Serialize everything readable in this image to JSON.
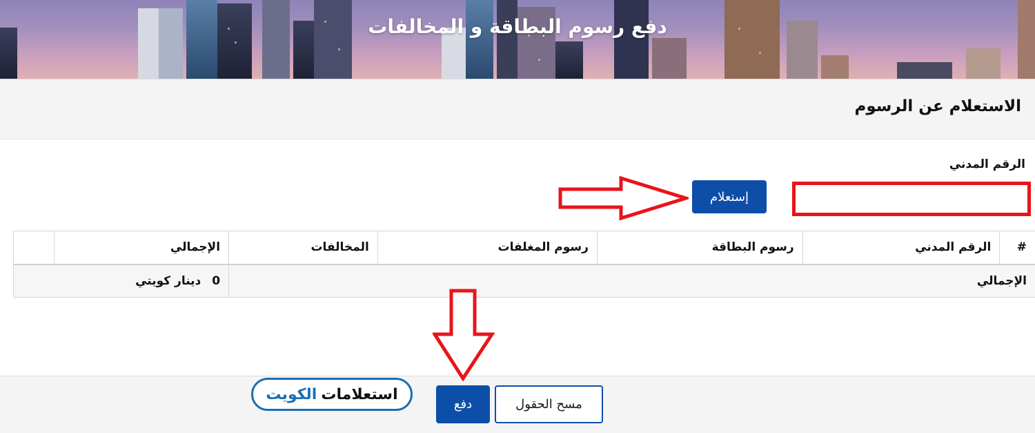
{
  "banner": {
    "title": "دفع رسوم البطاقة و المخالفات"
  },
  "section": {
    "title": "الاستعلام عن الرسوم"
  },
  "form": {
    "civil_id_label": "الرقم المدني",
    "civil_id_value": "",
    "inquire_label": "إستعلام"
  },
  "table": {
    "headers": [
      "#",
      "الرقم المدني",
      "رسوم البطاقة",
      "رسوم المغلفات",
      "المخالفات",
      "الإجمالي",
      ""
    ],
    "total_label": "الإجمالي",
    "total_amount": "0",
    "currency": "دينار كويتي"
  },
  "footer": {
    "clear_label": "مسح الحقول",
    "pay_label": "دفع"
  },
  "logo": {
    "word1": "استعلامات",
    "word2": "الكويت"
  },
  "colors": {
    "primary": "#0d4fa8",
    "highlight": "#e8141c",
    "logo_blue": "#1a6fb3"
  }
}
